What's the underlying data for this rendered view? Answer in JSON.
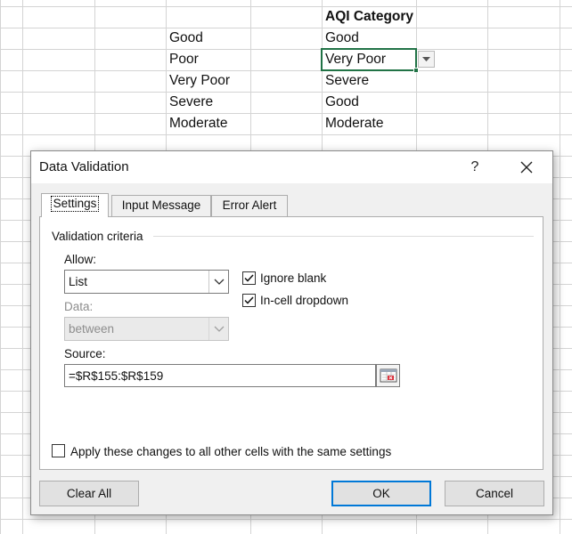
{
  "spreadsheet": {
    "header": "AQI Category",
    "col_a": [
      "Good",
      "Poor",
      "Very Poor",
      "Severe",
      "Moderate"
    ],
    "col_b": [
      "Good",
      "Very Poor",
      "Severe",
      "Good",
      "Moderate"
    ]
  },
  "dialog": {
    "title": "Data Validation",
    "help": "?",
    "tabs": [
      "Settings",
      "Input Message",
      "Error Alert"
    ],
    "active_tab": "Settings",
    "group_label": "Validation criteria",
    "allow": {
      "label": "Allow:",
      "value": "List"
    },
    "data": {
      "label": "Data:",
      "value": "between"
    },
    "ignore_blank": {
      "label": "Ignore blank",
      "checked": true
    },
    "in_cell_dropdown": {
      "label": "In-cell dropdown",
      "checked": true
    },
    "source": {
      "label": "Source:",
      "value": "=$R$155:$R$159"
    },
    "apply_all": {
      "label": "Apply these changes to all other cells with the same settings",
      "checked": false
    },
    "buttons": {
      "clear_all": "Clear All",
      "ok": "OK",
      "cancel": "Cancel"
    }
  },
  "colors": {
    "active_cell_border": "#217346",
    "default_button_border": "#0078d7"
  },
  "icons": [
    "chevron-down-icon",
    "close-icon",
    "check-icon",
    "collapse-dialog-icon"
  ]
}
